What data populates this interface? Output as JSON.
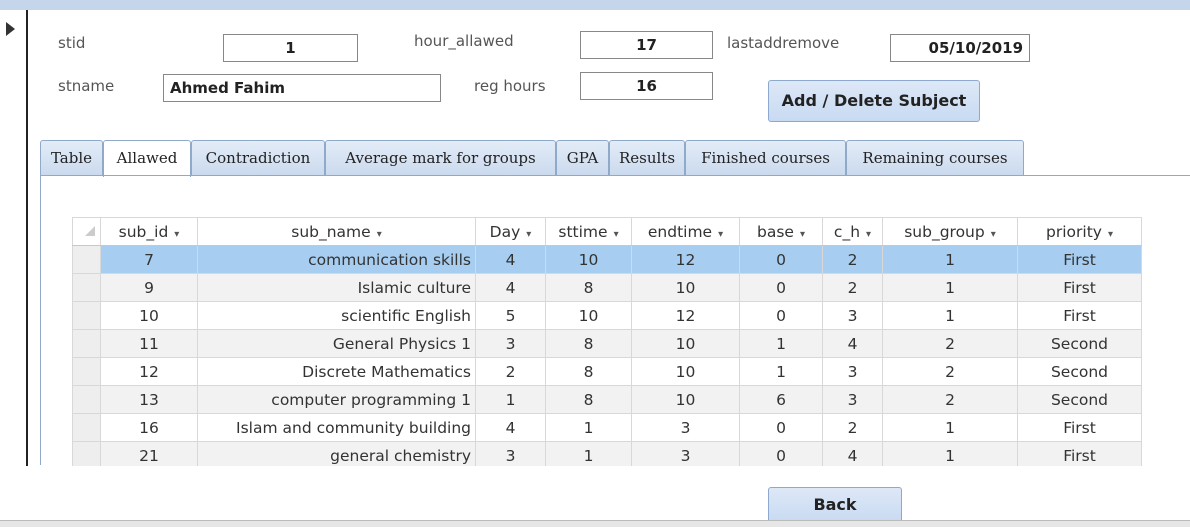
{
  "form": {
    "stid_label": "stid",
    "stid_value": "1",
    "hour_allawed_label": "hour_allawed",
    "hour_allawed_value": "17",
    "lastaddremove_label": "lastaddremove",
    "lastaddremove_value": "05/10/2019",
    "stname_label": "stname",
    "stname_value": "Ahmed Fahim",
    "reg_hours_label": "reg hours",
    "reg_hours_value": "16",
    "add_delete_label": "Add / Delete Subject",
    "back_label": "Back"
  },
  "tabs": [
    {
      "label": "Table"
    },
    {
      "label": "Allawed"
    },
    {
      "label": "Contradiction"
    },
    {
      "label": "Average mark for groups"
    },
    {
      "label": "GPA"
    },
    {
      "label": "Results"
    },
    {
      "label": "Finished courses"
    },
    {
      "label": "Remaining courses"
    }
  ],
  "grid": {
    "columns": [
      "sub_id",
      "sub_name",
      "Day",
      "sttime",
      "endtime",
      "base",
      "c_h",
      "sub_group",
      "priority"
    ],
    "rows": [
      [
        "7",
        "communication skills",
        "4",
        "10",
        "12",
        "0",
        "2",
        "1",
        "First"
      ],
      [
        "9",
        "Islamic culture",
        "4",
        "8",
        "10",
        "0",
        "2",
        "1",
        "First"
      ],
      [
        "10",
        "scientific English",
        "5",
        "10",
        "12",
        "0",
        "3",
        "1",
        "First"
      ],
      [
        "11",
        "General Physics 1",
        "3",
        "8",
        "10",
        "1",
        "4",
        "2",
        "Second"
      ],
      [
        "12",
        "Discrete Mathematics",
        "2",
        "8",
        "10",
        "1",
        "3",
        "2",
        "Second"
      ],
      [
        "13",
        "computer programming 1",
        "1",
        "8",
        "10",
        "6",
        "3",
        "2",
        "Second"
      ],
      [
        "16",
        "Islam and community building",
        "4",
        "1",
        "3",
        "0",
        "2",
        "1",
        "First"
      ],
      [
        "21",
        "general chemistry",
        "3",
        "1",
        "3",
        "0",
        "4",
        "1",
        "First"
      ]
    ]
  },
  "colors": {
    "selected_row": "#a7cdf0",
    "tab_border": "#8fa9c8",
    "button_bg": "#c8daf2"
  }
}
